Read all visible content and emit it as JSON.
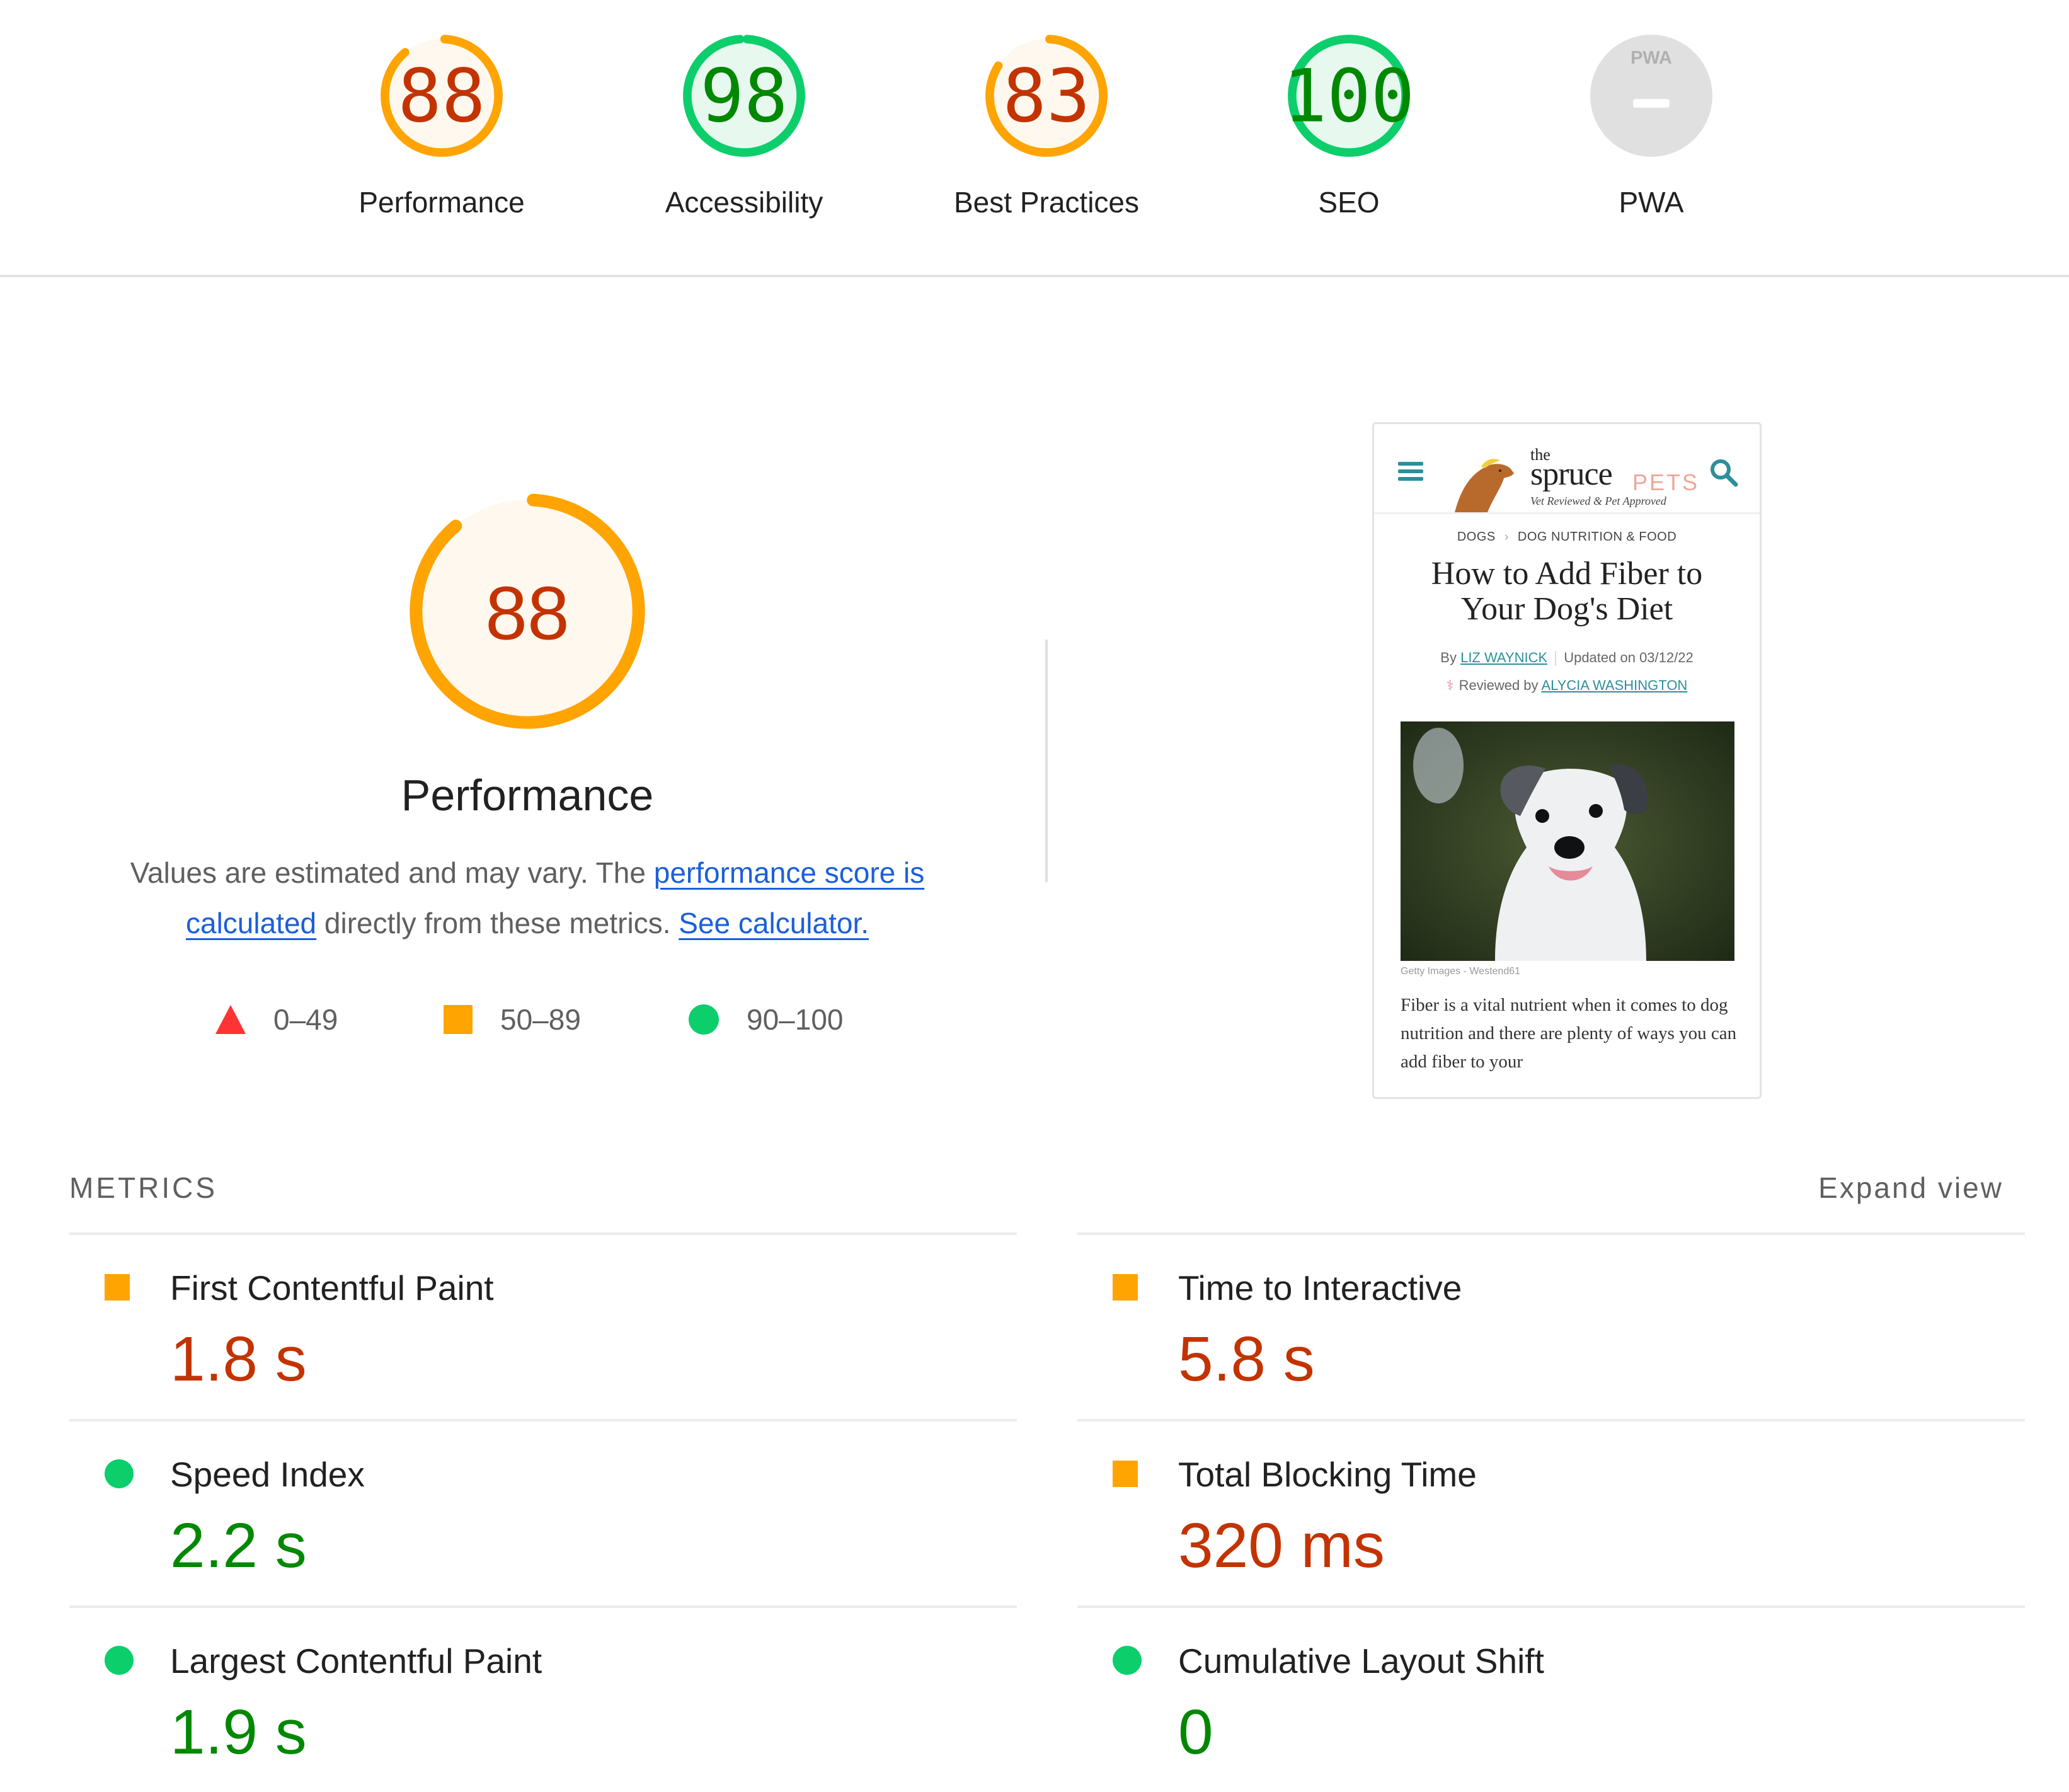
{
  "categories": [
    {
      "label": "Performance",
      "score": "88",
      "value": 88,
      "rating": "average"
    },
    {
      "label": "Accessibility",
      "score": "98",
      "value": 98,
      "rating": "pass"
    },
    {
      "label": "Best Practices",
      "score": "83",
      "value": 83,
      "rating": "average"
    },
    {
      "label": "SEO",
      "score": "100",
      "value": 100,
      "rating": "pass"
    },
    {
      "label": "PWA",
      "score": "",
      "value": null,
      "rating": "na",
      "badge": "PWA"
    }
  ],
  "performance": {
    "score": "88",
    "value": 88,
    "title": "Performance",
    "description_prefix": "Values are estimated and may vary. The ",
    "link_score": "performance score is calculated",
    "description_mid": " directly from these metrics. ",
    "link_calculator": "See calculator."
  },
  "legend": [
    {
      "label": "0–49",
      "shape": "triangle",
      "color": "#ff3333"
    },
    {
      "label": "50–89",
      "shape": "square",
      "color": "#ffa400"
    },
    {
      "label": "90–100",
      "shape": "circle",
      "color": "#0cce6b"
    }
  ],
  "thumbnail": {
    "logo_the": "the",
    "logo_spruce": "spruce",
    "logo_pets": "PETS",
    "logo_tagline": "Vet Reviewed & Pet Approved",
    "breadcrumb": [
      "DOGS",
      "DOG NUTRITION & FOOD"
    ],
    "breadcrumb_sep": "›",
    "title": "How to Add Fiber to Your Dog's Diet",
    "by_label": "By",
    "author": "LIZ WAYNICK",
    "updated": "Updated on 03/12/22",
    "reviewed_label": "Reviewed by",
    "reviewer": "ALYCIA WASHINGTON",
    "photo_credit": "Getty Images - Westend61",
    "body": "Fiber is a vital nutrient when it comes to dog nutrition and there are plenty of ways you can add fiber to your"
  },
  "metrics": {
    "heading": "METRICS",
    "expand_label": "Expand view",
    "left": [
      {
        "name": "First Contentful Paint",
        "value": "1.8 s",
        "rating": "average"
      },
      {
        "name": "Speed Index",
        "value": "2.2 s",
        "rating": "pass"
      },
      {
        "name": "Largest Contentful Paint",
        "value": "1.9 s",
        "rating": "pass"
      }
    ],
    "right": [
      {
        "name": "Time to Interactive",
        "value": "5.8 s",
        "rating": "average"
      },
      {
        "name": "Total Blocking Time",
        "value": "320 ms",
        "rating": "average"
      },
      {
        "name": "Cumulative Layout Shift",
        "value": "0",
        "rating": "pass"
      }
    ]
  },
  "colors": {
    "average_ring": "#ffa400",
    "average_fill": "#fff8ee",
    "average_text": "#c33300",
    "pass_ring": "#0cce6b",
    "pass_fill": "#e7f8ef",
    "pass_text": "#008800",
    "na_fill": "#e0e0e0",
    "link": "#1a5fdc"
  }
}
